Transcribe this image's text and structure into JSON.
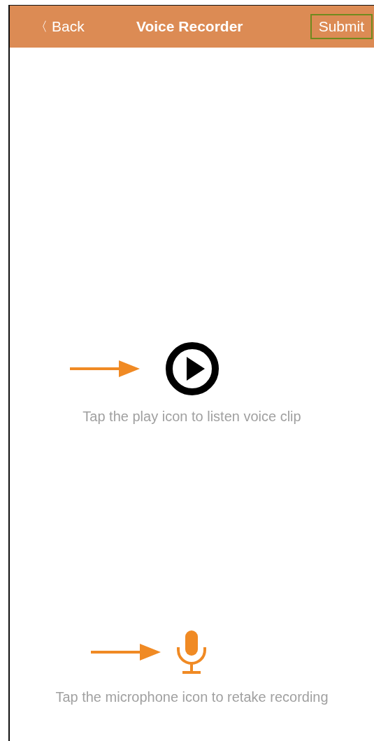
{
  "nav_bar": {
    "back": {
      "icon": "〈",
      "label": "Back"
    },
    "title": "Voice Recorder",
    "submit": {
      "label": "Submit",
      "highlighted": true
    }
  },
  "actions": [
    {
      "kind": "play",
      "hint": "Tap the play icon to listen voice clip",
      "pointer_arrow": true
    },
    {
      "kind": "microphone",
      "hint": "Tap the microphone icon to retake recording",
      "pointer_arrow": true
    }
  ]
}
